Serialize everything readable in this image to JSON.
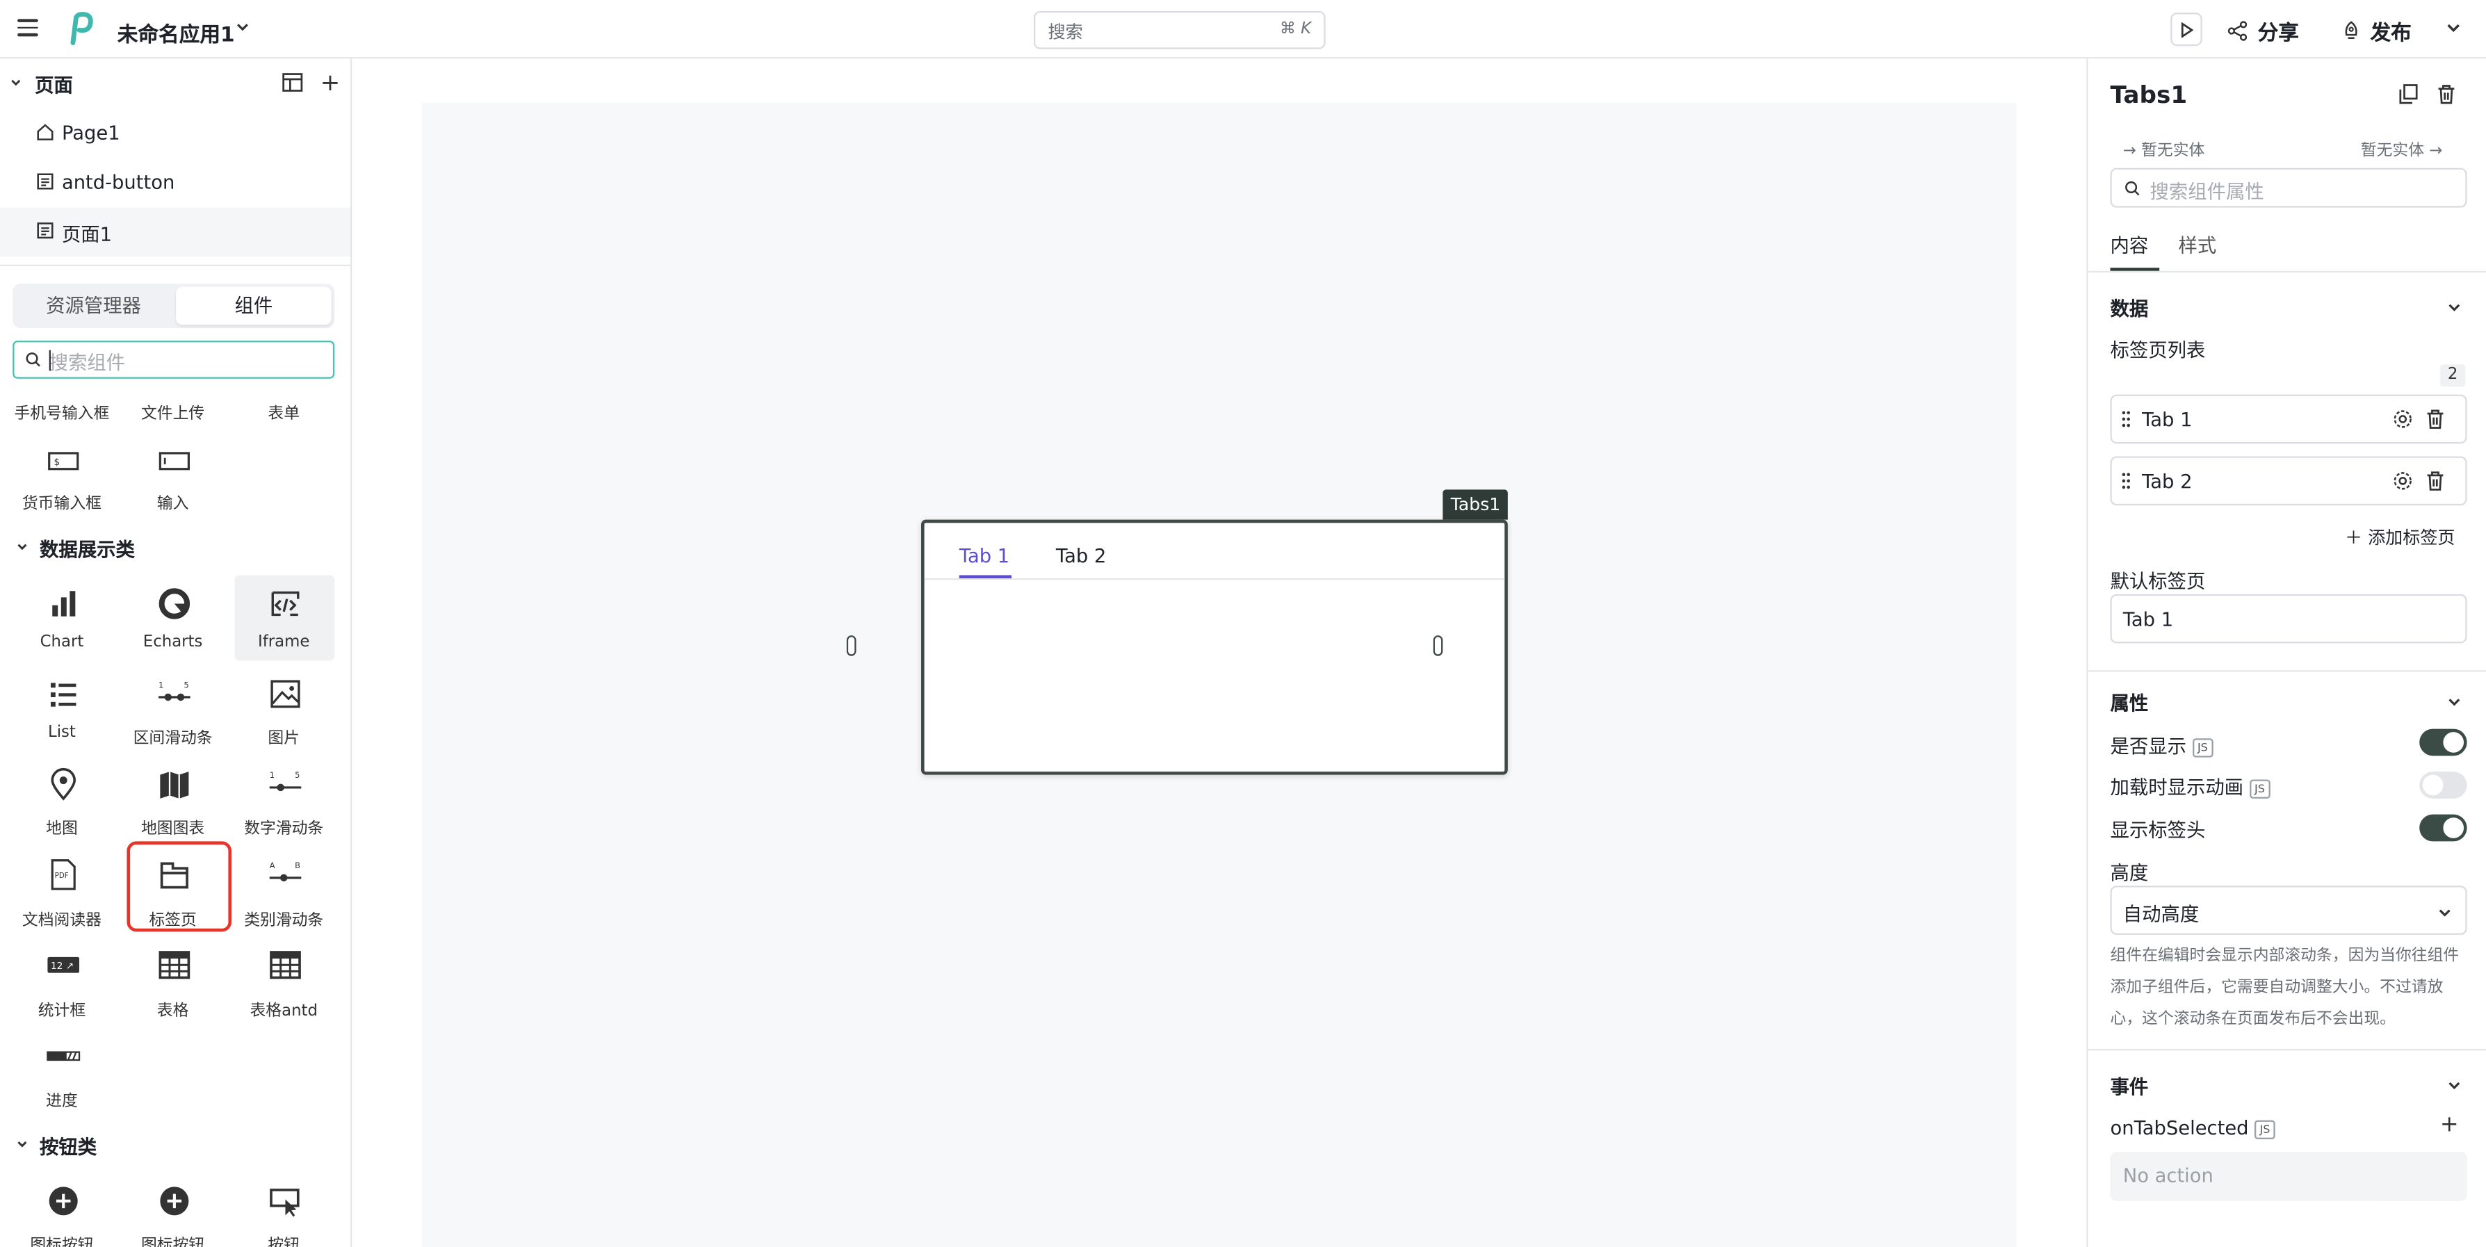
{
  "topbar": {
    "app_title": "未命名应用1",
    "search_placeholder": "搜索",
    "search_shortcut": "⌘ K",
    "share_label": "分享",
    "publish_label": "发布"
  },
  "pages": {
    "title": "页面",
    "items": [
      {
        "label": "Page1",
        "icon": "home-icon"
      },
      {
        "label": "antd-button",
        "icon": "page-icon"
      },
      {
        "label": "页面1",
        "icon": "page-icon"
      }
    ]
  },
  "left_tabs": {
    "explorer": "资源管理器",
    "components": "组件"
  },
  "component_search_placeholder": "搜索组件",
  "components": {
    "row_partial": [
      "手机号输入框",
      "文件上传",
      "表单"
    ],
    "row_inputs": [
      "货币输入框",
      "输入"
    ],
    "category_data": "数据展示类",
    "data_items": [
      "Chart",
      "Echarts",
      "Iframe",
      "List",
      "区间滑动条",
      "图片",
      "地图",
      "地图图表",
      "数字滑动条",
      "文档阅读器",
      "标签页",
      "类别滑动条",
      "统计框",
      "表格",
      "表格antd",
      "进度"
    ],
    "category_buttons": "按钮类",
    "button_items": [
      "图标按钮",
      "图标按钮",
      "按钮"
    ]
  },
  "canvas": {
    "widget_name": "Tabs1",
    "tabs": [
      "Tab 1",
      "Tab 2"
    ]
  },
  "inspector": {
    "title": "Tabs1",
    "nav_prev": "暂无实体",
    "nav_next": "暂无实体",
    "search_placeholder": "搜索组件属性",
    "tab_content": "内容",
    "tab_style": "样式",
    "section_data": "数据",
    "tab_list_label": "标签页列表",
    "tab_count": "2",
    "tab_list": [
      "Tab 1",
      "Tab 2"
    ],
    "add_tab": "添加标签页",
    "default_tab_label": "默认标签页",
    "default_tab_value": "Tab 1",
    "section_props": "属性",
    "visible_label": "是否显示",
    "animate_label": "加载时显示动画",
    "show_header_label": "显示标签头",
    "visible_on": true,
    "animate_on": false,
    "show_header_on": true,
    "height_label": "高度",
    "height_value": "自动高度",
    "hint": "组件在编辑时会显示内部滚动条，因为当你往组件添加子组件后，它需要自动调整大小。不过请放心，这个滚动条在页面发布后不会出现。",
    "section_events": "事件",
    "event_name": "onTabSelected",
    "no_action": "No action",
    "js_tag": "JS"
  },
  "colors": {
    "accent_purple": "#5b4dd4",
    "dark": "#2f3b37",
    "highlight_red": "#e5352b",
    "focus_teal": "#4dbeb4"
  }
}
